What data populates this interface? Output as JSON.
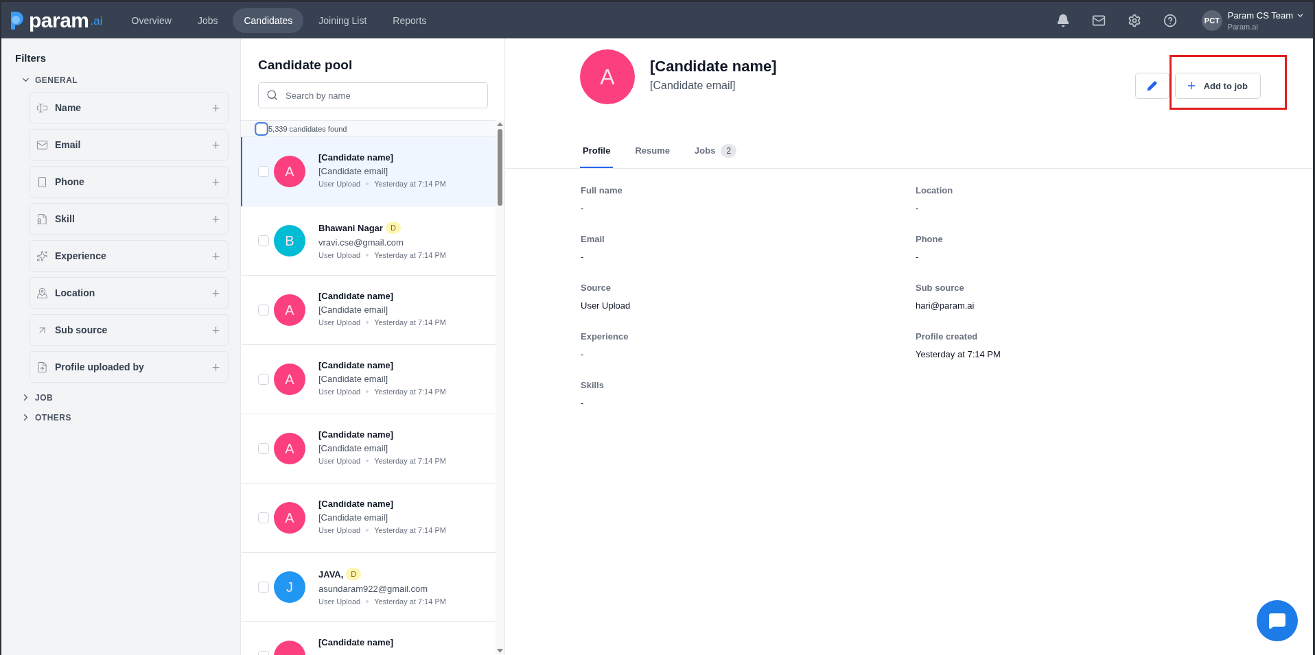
{
  "nav": {
    "logo": {
      "word": "param",
      "suffix": ".ai"
    },
    "tabs": [
      {
        "label": "Overview",
        "selected": false
      },
      {
        "label": "Jobs",
        "selected": false
      },
      {
        "label": "Candidates",
        "selected": true
      },
      {
        "label": "Joining List",
        "selected": false
      },
      {
        "label": "Reports",
        "selected": false
      }
    ],
    "user": {
      "initials": "PCT",
      "name": "Param CS Team",
      "org": "Param.ai"
    }
  },
  "filters": {
    "title": "Filters",
    "groups": [
      {
        "label": "GENERAL",
        "expanded": true,
        "items": [
          {
            "label": "Name",
            "kind": "name"
          },
          {
            "label": "Email",
            "kind": "email"
          },
          {
            "label": "Phone",
            "kind": "phone"
          },
          {
            "label": "Skill",
            "kind": "skill"
          },
          {
            "label": "Experience",
            "kind": "experience"
          },
          {
            "label": "Location",
            "kind": "location"
          },
          {
            "label": "Sub source",
            "kind": "subsource"
          },
          {
            "label": "Profile uploaded by",
            "kind": "upload"
          }
        ]
      },
      {
        "label": "JOB",
        "expanded": false
      },
      {
        "label": "OTHERS",
        "expanded": false
      }
    ]
  },
  "pool": {
    "title": "Candidate pool",
    "search": {
      "placeholder": "Search by name"
    },
    "count": "5,339 candidates found",
    "select_all": false,
    "candidates": [
      {
        "initial": "A",
        "color": "#fb3f7f",
        "name": "[Candidate name]",
        "email": "[Candidate email]",
        "source": "User Upload",
        "time": "Yesterday at 7:14 PM",
        "selected": true,
        "checked": false
      },
      {
        "initial": "B",
        "color": "#00bcd4",
        "name": "Bhawani Nagar",
        "badge": "D",
        "email": "vravi.cse@gmail.com",
        "source": "User Upload",
        "time": "Yesterday at 7:14 PM",
        "selected": false,
        "checked": false
      },
      {
        "initial": "A",
        "color": "#fb3f7f",
        "name": "[Candidate name]",
        "email": "[Candidate email]",
        "source": "User Upload",
        "time": "Yesterday at 7:14 PM",
        "selected": false,
        "checked": false
      },
      {
        "initial": "A",
        "color": "#fb3f7f",
        "name": "[Candidate name]",
        "email": "[Candidate email]",
        "source": "User Upload",
        "time": "Yesterday at 7:14 PM",
        "selected": false,
        "checked": false
      },
      {
        "initial": "A",
        "color": "#fb3f7f",
        "name": "[Candidate name]",
        "email": "[Candidate email]",
        "source": "User Upload",
        "time": "Yesterday at 7:14 PM",
        "selected": false,
        "checked": false
      },
      {
        "initial": "A",
        "color": "#fb3f7f",
        "name": "[Candidate name]",
        "email": "[Candidate email]",
        "source": "User Upload",
        "time": "Yesterday at 7:14 PM",
        "selected": false,
        "checked": false
      },
      {
        "initial": "J",
        "color": "#2196f3",
        "name": "JAVA,",
        "badge": "D",
        "email": "asundaram922@gmail.com",
        "source": "User Upload",
        "time": "Yesterday at 7:14 PM",
        "selected": false,
        "checked": false
      },
      {
        "color": "#fb3f7f",
        "name": "[Candidate name]",
        "selected": false,
        "checked": false
      }
    ]
  },
  "profile": {
    "initial": "A",
    "color": "#fb3f7f",
    "name": "[Candidate name]",
    "email": "[Candidate email]",
    "add_button": {
      "label": "Add to job",
      "highlighted": true
    },
    "tabs": [
      {
        "label": "Profile",
        "selected": true
      },
      {
        "label": "Resume",
        "selected": false
      },
      {
        "label": "Jobs",
        "count": "2",
        "selected": false
      }
    ],
    "fields": [
      {
        "label": "Full name",
        "value": "-"
      },
      {
        "label": "Location",
        "value": "-"
      },
      {
        "label": "Email",
        "value": "-"
      },
      {
        "label": "Phone",
        "value": "-"
      },
      {
        "label": "Source",
        "value": "User Upload"
      },
      {
        "label": "Sub source",
        "value": "hari@param.ai"
      },
      {
        "label": "Experience",
        "value": "-"
      },
      {
        "label": "Profile created",
        "value": "Yesterday at 7:14 PM"
      },
      {
        "label": "Skills",
        "value": "-"
      }
    ]
  }
}
